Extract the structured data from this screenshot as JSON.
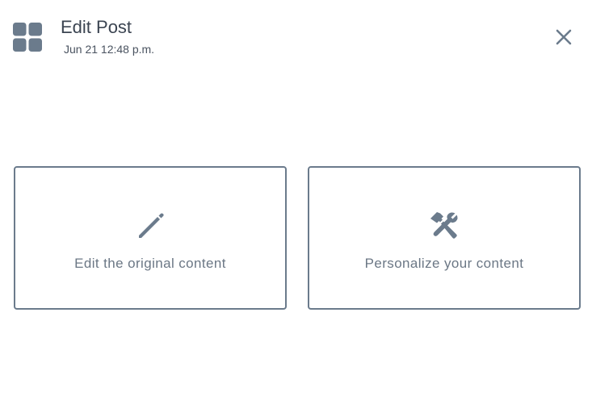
{
  "header": {
    "app_icon": "grid-icon",
    "title": "Edit Post",
    "timestamp": "Jun 21 12:48 p.m.",
    "close_icon": "close-icon"
  },
  "options": [
    {
      "icon": "pencil-icon",
      "label": "Edit the original content"
    },
    {
      "icon": "tools-icon",
      "label": "Personalize your content"
    }
  ],
  "colors": {
    "icon": "#6b7b8c",
    "border": "#6b7b8c",
    "title_text": "#3b4451",
    "label_text": "#6b7785"
  }
}
